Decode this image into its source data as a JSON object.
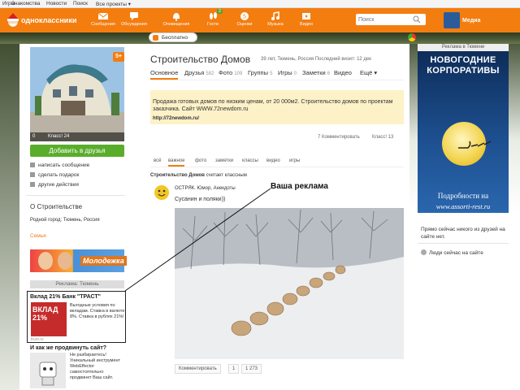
{
  "topbar": {
    "links": [
      "Игры",
      "Знакомства",
      "Новости",
      "Поиск",
      "Все проекты ▾"
    ]
  },
  "header": {
    "logo_text": "одноклассники",
    "nav": [
      {
        "label": "Сообщения",
        "icon": "envelope-icon"
      },
      {
        "label": "Обсуждения",
        "icon": "chat-icon"
      },
      {
        "label": "Оповещения",
        "icon": "bell-icon"
      },
      {
        "label": "Гости",
        "icon": "footprints-icon",
        "badge": "2"
      },
      {
        "label": "Оценки",
        "icon": "rating-icon"
      },
      {
        "label": "Музыка",
        "icon": "music-icon"
      },
      {
        "label": "Видео",
        "icon": "video-icon"
      }
    ],
    "search_placeholder": "Поиск",
    "media_label": "Медиа"
  },
  "free_button": "Бесплатно",
  "profile": {
    "name": "Строительство Домов",
    "meta": "39 лет, Тюмень, Россия Последний визит: 12 дек",
    "badge": "5+",
    "photo_stats": {
      "comments": "0",
      "likes": "Класс! 24"
    },
    "tabs": [
      {
        "label": "Основное",
        "count": ""
      },
      {
        "label": "Друзья",
        "count": "582"
      },
      {
        "label": "Фото",
        "count": "109"
      },
      {
        "label": "Группы",
        "count": "5"
      },
      {
        "label": "Игры",
        "count": "0"
      },
      {
        "label": "Заметки",
        "count": "6"
      },
      {
        "label": "Видео",
        "count": ""
      },
      {
        "label": "Ещё ▾",
        "count": ""
      }
    ]
  },
  "left": {
    "add_friend": "Добавить в друзья",
    "actions": [
      "написать сообщение",
      "сделать подарок",
      "другие действия"
    ],
    "about_title": "О Строительстве",
    "hometown": "Родной город: Тюмень, Россия",
    "family": "Семья",
    "banner_text": "Молодежка",
    "ad_label": "Реклама: Тюмень",
    "trust": {
      "title": "Вклад 21% Банк \"ТРАСТ\"",
      "img_text": "ВКЛАД 21%",
      "desc": "Выгодные условия по вкладам. Ставка в валюте 8%. Ставка в рублях 21%!",
      "source": "trust.ru"
    },
    "promote": {
      "title": "И как же продвинуть сайт?",
      "desc": "Не разбираетесь! Уникальный инструмент WebEffector самостоятельно продвинет Ваш сайт."
    }
  },
  "status": {
    "text": "Продажа готовых домов по низким ценам, от 20 000м2. Строительство домов по проектам заказчика.          Сайт   WWW.72newdom.ru",
    "link": "http://72newdom.ru/",
    "comments": "7 Комментировать",
    "likes": "Класс! 13"
  },
  "feed": {
    "tabs": [
      "всё",
      "важное",
      "фото",
      "заметки",
      "классы",
      "видео",
      "игры"
    ],
    "post_header_author": "Строительство Домов",
    "post_header_action": "считает классным",
    "group": "ОСТРЯК. Юмор, Анекдоты",
    "text": "Сусанин и поляки))",
    "actions": {
      "comment": "Комментировать",
      "count": "1",
      "likes": "1 273"
    }
  },
  "annotation": "Ваша реклама",
  "right": {
    "ad_label": "Реклама в Тюмени",
    "ad_title": "НОВОГОДНИЕ КОРПОРАТИВЫ",
    "ad_more": "Подробности на",
    "ad_url": "www.assorti-rest.ru",
    "online_note": "Прямо сейчас никого из друзей на сайте нет.",
    "online_link": "Люди сейчас на сайте"
  },
  "colors": {
    "accent": "#f47d0f",
    "green": "#59ad2b",
    "status_bg": "#fdf1c8"
  }
}
